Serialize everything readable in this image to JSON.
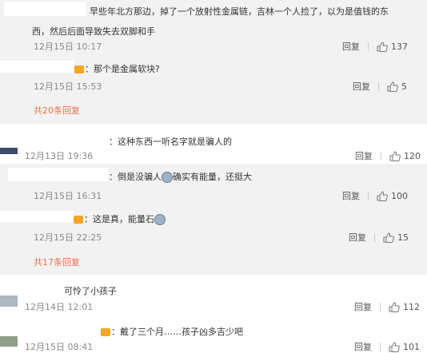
{
  "comments": [
    {
      "text_line1": "早些年北方那边，掉了一个放射性金属链，吉林一个人捡了，以为是值钱的东",
      "text_line2": "西，然后后面导致失去双脚和手",
      "time": "12月15日 10:17",
      "reply": "回复",
      "likes": "137"
    },
    {
      "text": "：那个是金属软块?",
      "time": "12月15日 15:53",
      "reply": "回复",
      "likes": "5"
    },
    {
      "more": "共20条回复"
    },
    {
      "text": "：这种东西一听名字就是骗人的",
      "time": "12月13日 19:36",
      "reply": "回复",
      "likes": "120"
    },
    {
      "text_a": "：倒是没骗人",
      "text_b": "确实有能量，还挺大",
      "time": "12月15日 16:31",
      "reply": "回复",
      "likes": "100"
    },
    {
      "text": "：这是真，能量石",
      "time": "12月15日 22:25",
      "reply": "回复",
      "likes": "15"
    },
    {
      "more": "共17条回复"
    },
    {
      "text": "可怜了小孩子",
      "time": "12月14日 12:01",
      "reply": "回复",
      "likes": "112"
    },
    {
      "text": "：戴了三个月……孩子凶多吉少吧",
      "time": "12月15日 08:41",
      "reply": "回复",
      "likes": "101"
    }
  ],
  "icons": {
    "like": "thumbs-up-icon",
    "vip": "vip-badge-icon",
    "emoji": "doge-emoji-icon"
  },
  "colors": {
    "link": "#eb7350",
    "nested_bg": "#f2f2f2"
  }
}
